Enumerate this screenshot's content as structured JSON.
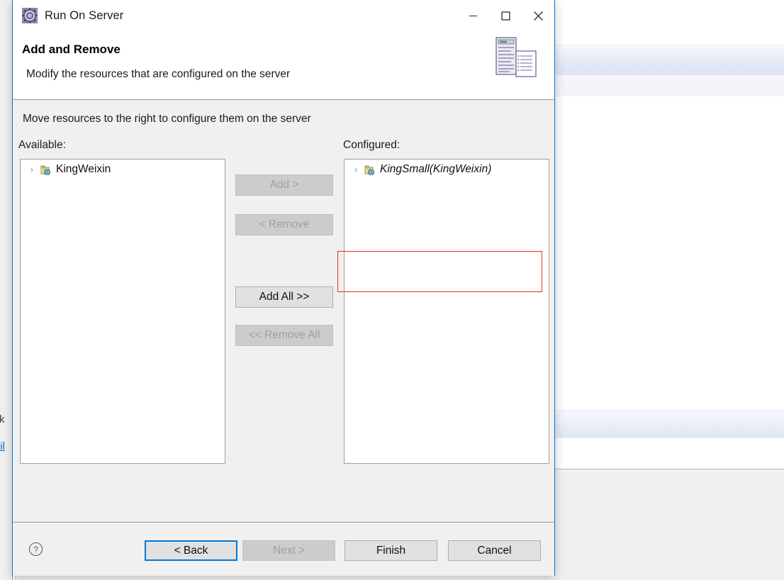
{
  "window": {
    "title": "Run On Server",
    "app_icon": "gear-icon",
    "controls": {
      "minimize": "minimize-icon",
      "maximize": "maximize-icon",
      "close": "close-icon"
    }
  },
  "header": {
    "title": "Add and Remove",
    "subtitle": "Modify the resources that are configured on the server",
    "banner_icon": "server-and-document-icon"
  },
  "main": {
    "instruction": "Move resources to the right to configure them on the server",
    "available": {
      "label": "Available:",
      "items": [
        {
          "label": "KingWeixin",
          "icon": "project-module-icon",
          "arrow": "›",
          "italic": false
        }
      ]
    },
    "configured": {
      "label": "Configured:",
      "items": [
        {
          "label": "KingSmall(KingWeixin)",
          "icon": "project-module-icon",
          "arrow": "›",
          "italic": true
        }
      ],
      "annotation_color": "#e03030"
    },
    "transfer_buttons": [
      {
        "name": "add",
        "label": "Add >",
        "enabled": false
      },
      {
        "name": "remove",
        "label": "< Remove",
        "enabled": false
      },
      {
        "name": "add-all",
        "label": "Add All >>",
        "enabled": true
      },
      {
        "name": "remove-all",
        "label": "<< Remove All",
        "enabled": false
      }
    ]
  },
  "footer": {
    "help_icon": "help-circle-icon",
    "buttons": [
      {
        "name": "back",
        "label": "< Back",
        "enabled": true,
        "focused": true
      },
      {
        "name": "next",
        "label": "Next >",
        "enabled": false,
        "focused": false
      },
      {
        "name": "finish",
        "label": "Finish",
        "enabled": true,
        "focused": false
      },
      {
        "name": "cancel",
        "label": "Cancel",
        "enabled": true,
        "focused": false
      }
    ]
  },
  "background": {
    "clipped_word": "rk",
    "clipped_link": "ail"
  },
  "colors": {
    "accent": "#0078d7",
    "annotation": "#e03030",
    "dialog_bg": "#f0f0f0",
    "link": "#1a63c8"
  }
}
